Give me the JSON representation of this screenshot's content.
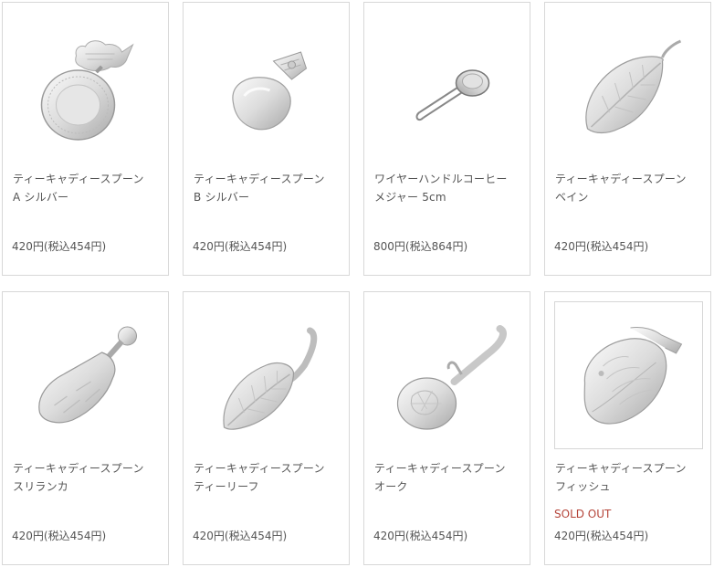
{
  "products": [
    {
      "name_line1": "ティーキャディースプーン",
      "name_line2": "A シルバー",
      "price": "420円(税込454円)",
      "status": "",
      "icon": "teapot-caddy-spoon-image"
    },
    {
      "name_line1": "ティーキャディースプーン",
      "name_line2": "B シルバー",
      "price": "420円(税込454円)",
      "status": "",
      "icon": "shell-caddy-spoon-image"
    },
    {
      "name_line1": "ワイヤーハンドルコーヒー",
      "name_line2": "メジャー 5cm",
      "price": "800円(税込864円)",
      "status": "",
      "icon": "wire-measure-spoon-image"
    },
    {
      "name_line1": "ティーキャディースプーン",
      "name_line2": "ベイン",
      "price": "420円(税込454円)",
      "status": "",
      "icon": "vein-leaf-spoon-image"
    },
    {
      "name_line1": "ティーキャディースプーン",
      "name_line2": "スリランカ",
      "price": "420円(税込454円)",
      "status": "",
      "icon": "sri-lanka-spoon-image"
    },
    {
      "name_line1": "ティーキャディースプーン",
      "name_line2": "ティーリーフ",
      "price": "420円(税込454円)",
      "status": "",
      "icon": "tea-leaf-spoon-image"
    },
    {
      "name_line1": "ティーキャディースプーン",
      "name_line2": "オーク",
      "price": "420円(税込454円)",
      "status": "",
      "icon": "oak-spoon-image"
    },
    {
      "name_line1": "ティーキャディースプーン",
      "name_line2": "フィッシュ",
      "price": "420円(税込454円)",
      "status": "SOLD OUT",
      "icon": "fish-spoon-image"
    }
  ],
  "colors": {
    "border": "#d8d8d8",
    "text": "#555555",
    "sold_out": "#b5453a"
  }
}
